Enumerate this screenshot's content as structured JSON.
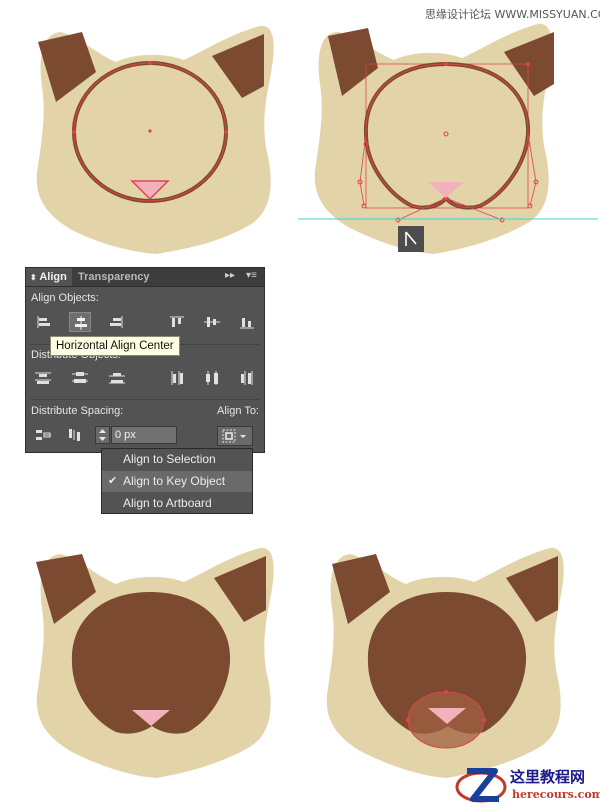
{
  "watermark_top": "思缘设计论坛 WWW.MISSYUAN.COM",
  "colors": {
    "fur": "#e3d3a8",
    "ear_inner": "#7b4a30",
    "mask": "#7b4a30",
    "nose": "#f3b1bd",
    "selection": "#e0444a",
    "guide": "#38d7d7",
    "panel_bg": "#535353"
  },
  "align_panel": {
    "tab_active": "Align",
    "tab_inactive": "Transparency",
    "align_objects_label": "Align Objects:",
    "distribute_objects_label": "Distribute Objects:",
    "distribute_spacing_label": "Distribute Spacing:",
    "align_to_label": "Align To:",
    "spacing_value": "0 px",
    "tooltip": "Horizontal Align Center",
    "align_objects_icons": [
      "horizontal-align-left-icon",
      "horizontal-align-center-icon",
      "horizontal-align-right-icon",
      "vertical-align-top-icon",
      "vertical-align-center-icon",
      "vertical-align-bottom-icon"
    ],
    "distribute_objects_icons": [
      "vertical-distribute-top-icon",
      "vertical-distribute-center-icon",
      "vertical-distribute-bottom-icon",
      "horizontal-distribute-left-icon",
      "horizontal-distribute-center-icon",
      "horizontal-distribute-right-icon"
    ],
    "selected_icon": "horizontal-align-center-icon"
  },
  "align_to_menu": {
    "items": [
      "Align to Selection",
      "Align to Key Object",
      "Align to Artboard"
    ],
    "checked_index": 1
  },
  "logo": {
    "title_cn": "这里教程网",
    "url": "herecours.com"
  }
}
